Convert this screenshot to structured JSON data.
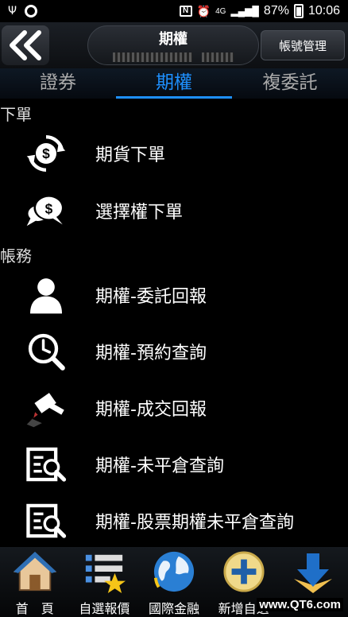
{
  "status_bar": {
    "signal_label": "4G",
    "battery": "87%",
    "time": "10:06"
  },
  "header": {
    "title": "期權",
    "account_masked": "",
    "account_button": "帳號管理"
  },
  "tabs": [
    {
      "label": "證券",
      "active": false
    },
    {
      "label": "期權",
      "active": true
    },
    {
      "label": "複委託",
      "active": false
    }
  ],
  "sections": [
    {
      "label": "下單",
      "items": [
        {
          "label": "期貨下單",
          "icon": "dollar-cycle-icon"
        },
        {
          "label": "選擇權下單",
          "icon": "dollar-chat-icon"
        }
      ]
    },
    {
      "label": "帳務",
      "items": [
        {
          "label": "期權-委託回報",
          "icon": "person-icon"
        },
        {
          "label": "期權-預約查詢",
          "icon": "clock-search-icon"
        },
        {
          "label": "期權-成交回報",
          "icon": "gavel-icon"
        },
        {
          "label": "期權-未平倉查詢",
          "icon": "document-search-icon"
        },
        {
          "label": "期權-股票期權未平倉查詢",
          "icon": "document-search-icon"
        }
      ]
    }
  ],
  "bottom_nav": [
    {
      "label": "首　頁",
      "icon": "home-icon"
    },
    {
      "label": "自選報價",
      "icon": "watchlist-icon"
    },
    {
      "label": "國際金融",
      "icon": "globe-icon"
    },
    {
      "label": "新增自選",
      "icon": "add-icon"
    },
    {
      "label": "",
      "icon": "download-icon"
    }
  ],
  "watermark": "www.QT6.com",
  "colors": {
    "accent": "#1e90ff",
    "background": "#000000"
  }
}
